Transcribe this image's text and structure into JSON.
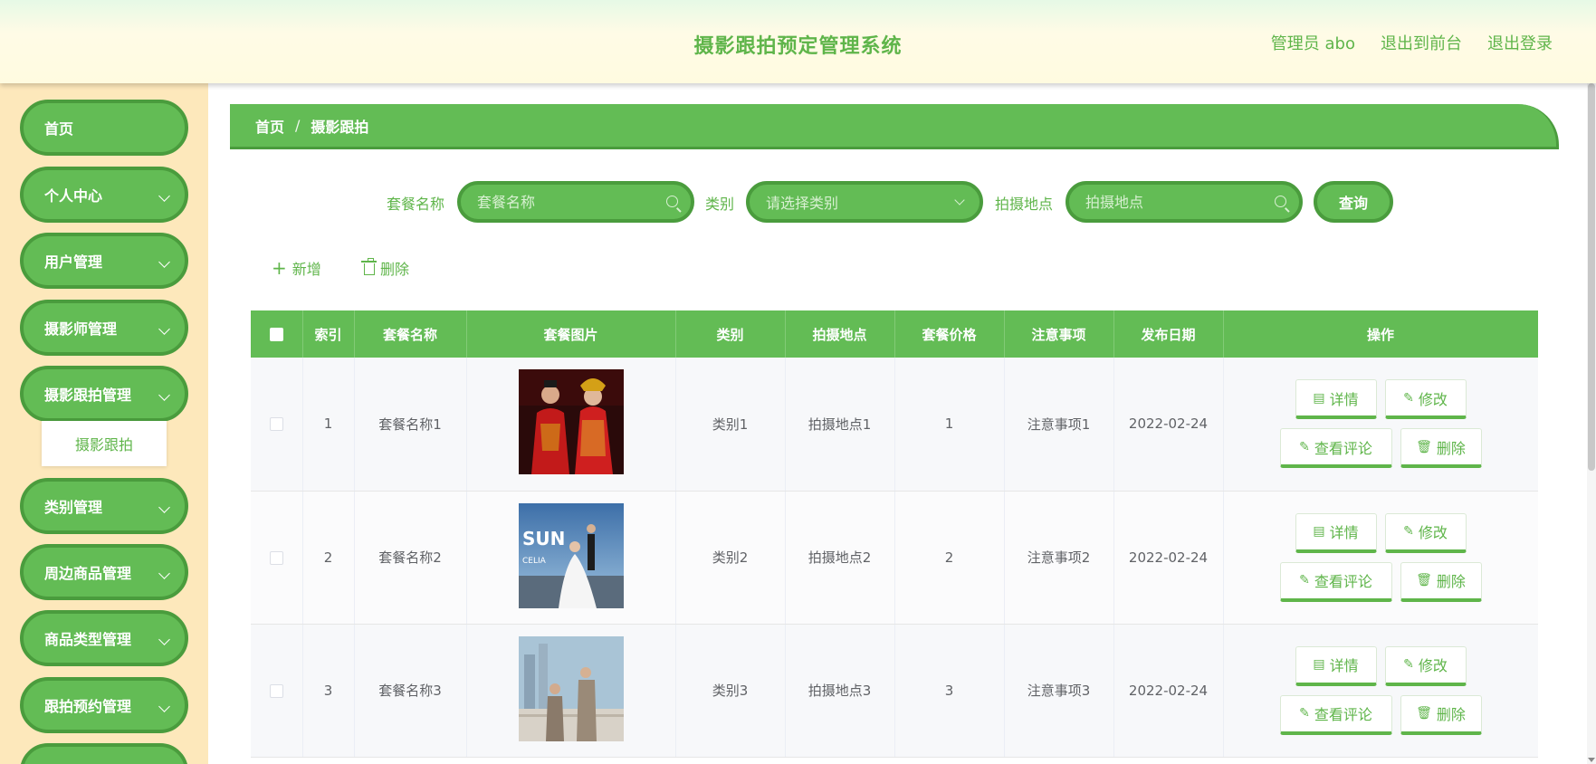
{
  "header": {
    "title": "摄影跟拍预定管理系统",
    "user_label": "管理员 abo",
    "back_front_label": "退出到前台",
    "logout_label": "退出登录"
  },
  "sidebar": {
    "items": [
      {
        "label": "首页",
        "has_children": false
      },
      {
        "label": "个人中心",
        "has_children": true
      },
      {
        "label": "用户管理",
        "has_children": true
      },
      {
        "label": "摄影师管理",
        "has_children": true
      },
      {
        "label": "摄影跟拍管理",
        "has_children": true,
        "expanded": true
      },
      {
        "label": "类别管理",
        "has_children": true
      },
      {
        "label": "周边商品管理",
        "has_children": true
      },
      {
        "label": "商品类型管理",
        "has_children": true
      },
      {
        "label": "跟拍预约管理",
        "has_children": true
      }
    ],
    "subitem": "摄影跟拍"
  },
  "breadcrumb": {
    "home": "首页",
    "separator": "/",
    "current": "摄影跟拍"
  },
  "search": {
    "name_label": "套餐名称",
    "name_placeholder": "套餐名称",
    "category_label": "类别",
    "category_placeholder": "请选择类别",
    "location_label": "拍摄地点",
    "location_placeholder": "拍摄地点",
    "query_button": "查询"
  },
  "toolbar": {
    "add_label": "新增",
    "delete_label": "删除"
  },
  "table": {
    "columns": [
      "索引",
      "套餐名称",
      "套餐图片",
      "类别",
      "拍摄地点",
      "套餐价格",
      "注意事项",
      "发布日期",
      "操作"
    ],
    "rows": [
      {
        "index": "1",
        "name": "套餐名称1",
        "category": "类别1",
        "location": "拍摄地点1",
        "price": "1",
        "notes": "注意事项1",
        "date": "2022-02-24",
        "image": "red-traditional-wedding-couple"
      },
      {
        "index": "2",
        "name": "套餐名称2",
        "category": "类别2",
        "location": "拍摄地点2",
        "price": "2",
        "notes": "注意事项2",
        "date": "2022-02-24",
        "image": "white-gown-seaside-couple"
      },
      {
        "index": "3",
        "name": "套餐名称3",
        "category": "类别3",
        "location": "拍摄地点3",
        "price": "3",
        "notes": "注意事项3",
        "date": "2022-02-24",
        "image": "suited-couple-city"
      }
    ],
    "actions": {
      "detail": "详情",
      "edit": "修改",
      "comments": "查看评论",
      "delete": "删除"
    }
  },
  "colors": {
    "primary": "#63bc55",
    "primary_dark": "#4a9c3d",
    "sidebar_bg": "#fde8bb",
    "header_text": "#5fb54a"
  }
}
